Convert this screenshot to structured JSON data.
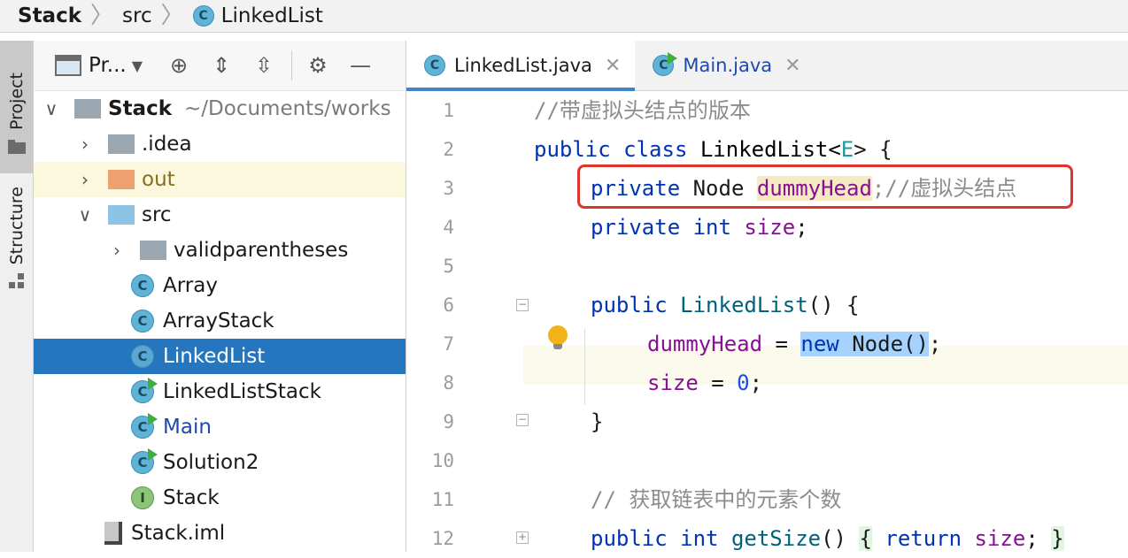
{
  "breadcrumb": {
    "root": "Stack",
    "mid": "src",
    "file": "LinkedList"
  },
  "toolwindows": {
    "project": "Project",
    "structure": "Structure"
  },
  "project_toolbar": {
    "view_label": "Pr..."
  },
  "tree": [
    {
      "label": "Stack",
      "suffix": "~/Documents/works",
      "kind": "root"
    },
    {
      "label": ".idea",
      "kind": "folder"
    },
    {
      "label": "out",
      "kind": "folder-orange"
    },
    {
      "label": "src",
      "kind": "folder-blue"
    },
    {
      "label": "validparentheses",
      "kind": "package"
    },
    {
      "label": "Array",
      "kind": "class"
    },
    {
      "label": "ArrayStack",
      "kind": "class"
    },
    {
      "label": "LinkedList",
      "kind": "class",
      "selected": true
    },
    {
      "label": "LinkedListStack",
      "kind": "class-run"
    },
    {
      "label": "Main",
      "kind": "class-run"
    },
    {
      "label": "Solution2",
      "kind": "class-run"
    },
    {
      "label": "Stack",
      "kind": "interface"
    },
    {
      "label": "Stack.iml",
      "kind": "file"
    }
  ],
  "tabs": [
    {
      "label": "LinkedList.java",
      "active": true
    },
    {
      "label": "Main.java",
      "active": false
    }
  ],
  "line_numbers": [
    "1",
    "2",
    "3",
    "4",
    "5",
    "6",
    "7",
    "8",
    "9",
    "10",
    "11",
    "12"
  ],
  "code": {
    "l1": "//带虚拟头结点的版本",
    "l2_kw": "public class",
    "l2_name": "LinkedList<",
    "l2_gen": "E",
    "l2_end": "> {",
    "l3_kw": "private",
    "l3_type": "Node",
    "l3_field": "dummyHead",
    "l3_cmt": ";//虚拟头结点",
    "l4_kw": "private int",
    "l4_field": "size",
    "l4_end": ";",
    "l6_kw": "public",
    "l6_name": "LinkedList",
    "l6_end": "() {",
    "l7_field": "dummyHead",
    "l7_eq": " = ",
    "l7_new": "new",
    "l7_rest": " Node()",
    "l7_end": ";",
    "l8_field": "size",
    "l8_eq": " = ",
    "l8_num": "0",
    "l8_end": ";",
    "l9": "}",
    "l11": "// 获取链表中的元素个数",
    "l12_kw": "public int",
    "l12_name": "getSize",
    "l12_paren": "() ",
    "l12_brace": "{",
    "l12_ret": "return",
    "l12_field": "size",
    "l12_semi": ";",
    "l12_close": "}"
  }
}
